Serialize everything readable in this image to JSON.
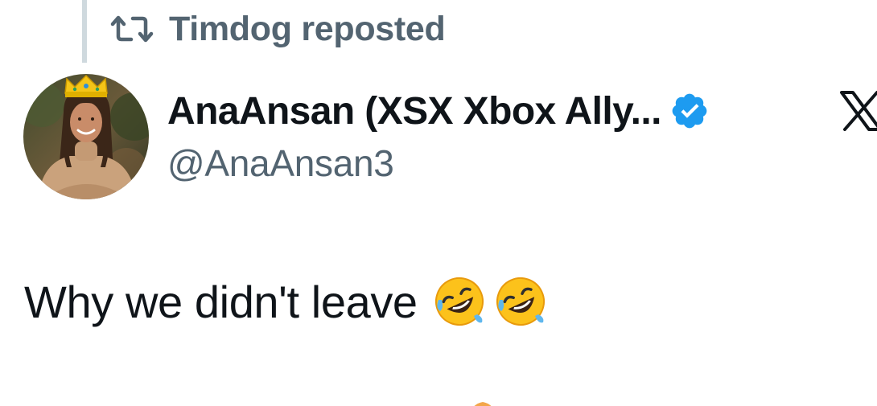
{
  "repost": {
    "text": "Timdog reposted",
    "icon": "repost-icon"
  },
  "author": {
    "display_name": "AnaAnsan (XSX Xbox Ally...",
    "handle": "@AnaAnsan3",
    "verified_icon": "verified-badge-icon",
    "avatar_icon": "avatar-with-crown"
  },
  "platform": {
    "logo_icon": "x-logo-icon"
  },
  "tweet": {
    "text": "Why we didn't leave",
    "emojis": [
      "rolling-on-floor-laughing-emoji",
      "rolling-on-floor-laughing-emoji"
    ]
  },
  "colors": {
    "primary_text": "#0f1419",
    "secondary_text": "#536471",
    "verified_blue": "#1d9bf0",
    "thread_line": "#cfd9de"
  }
}
